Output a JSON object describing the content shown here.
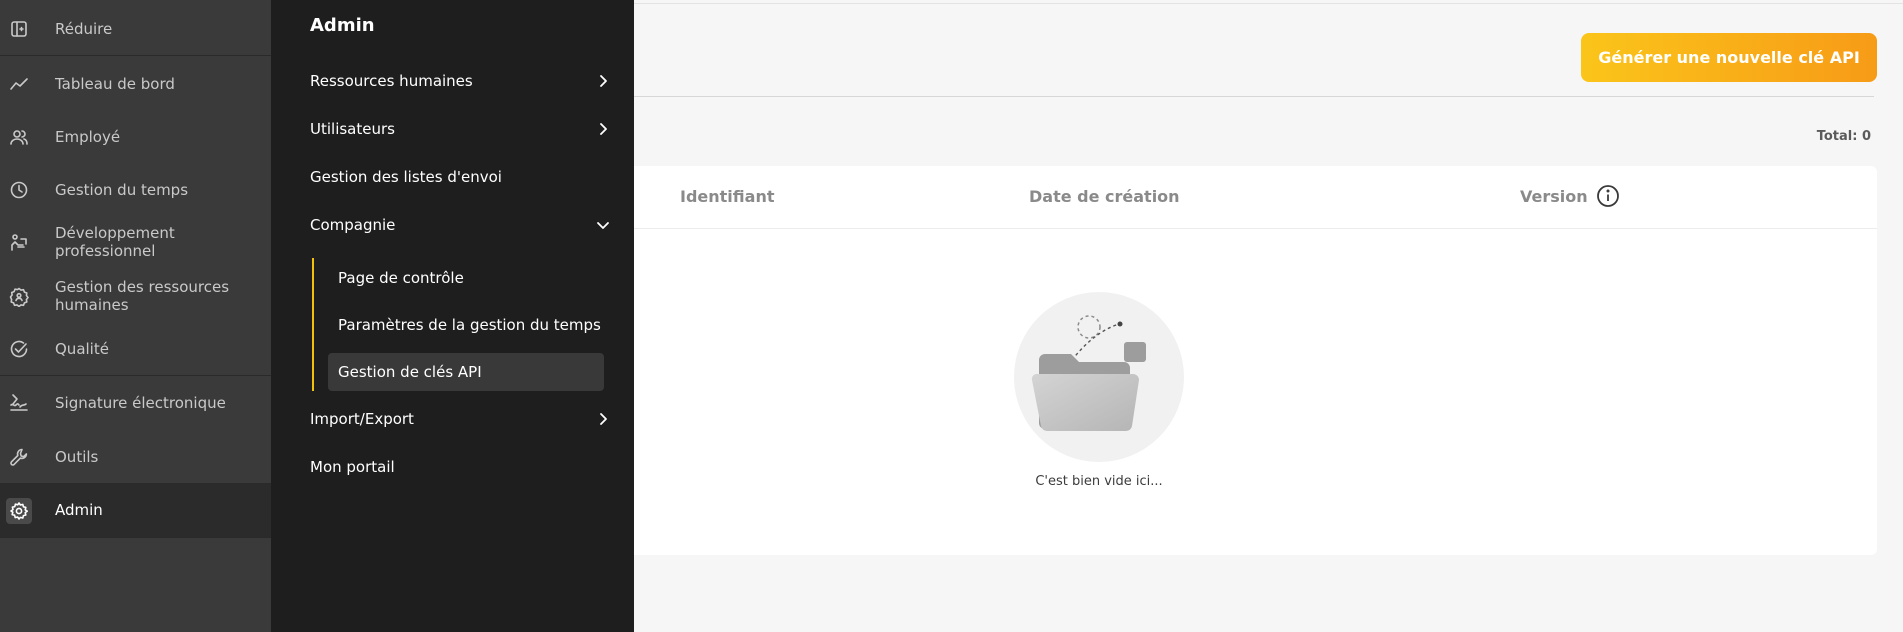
{
  "sidebar": {
    "items": [
      {
        "label": "Réduire",
        "icon": "collapse-icon"
      },
      {
        "label": "Tableau de bord",
        "icon": "chart-line-icon"
      },
      {
        "label": "Employé",
        "icon": "users-icon"
      },
      {
        "label": "Gestion du temps",
        "icon": "clock-icon"
      },
      {
        "label": "Développement professionnel",
        "icon": "growth-icon"
      },
      {
        "label": "Gestion des ressources humaines",
        "icon": "hr-gear-icon"
      },
      {
        "label": "Qualité",
        "icon": "check-circle-icon"
      },
      {
        "label": "Signature électronique",
        "icon": "signature-icon"
      },
      {
        "label": "Outils",
        "icon": "wrench-icon"
      },
      {
        "label": "Admin",
        "icon": "gear-icon"
      }
    ]
  },
  "admin_menu": {
    "title": "Admin",
    "items": [
      {
        "label": "Ressources humaines"
      },
      {
        "label": "Utilisateurs"
      },
      {
        "label": "Gestion des listes d'envoi"
      },
      {
        "label": "Compagnie"
      },
      {
        "label": "Import/Export"
      },
      {
        "label": "Mon portail"
      }
    ],
    "compagnie_children": [
      {
        "label": "Page de contrôle"
      },
      {
        "label": "Paramètres de la gestion du temps"
      },
      {
        "label": "Gestion de clés API"
      }
    ]
  },
  "main": {
    "generate_button": "Générer une nouvelle clé API",
    "total_label": "Total: 0",
    "columns": [
      "Identifiant",
      "Date de création",
      "Version"
    ],
    "empty_text": "C'est bien vide ici..."
  },
  "colors": {
    "accent_start": "#fbc51a",
    "accent_end": "#f79b17",
    "sidebar_bg": "#3a3a3a",
    "submenu_bg": "#1e1e1e"
  }
}
